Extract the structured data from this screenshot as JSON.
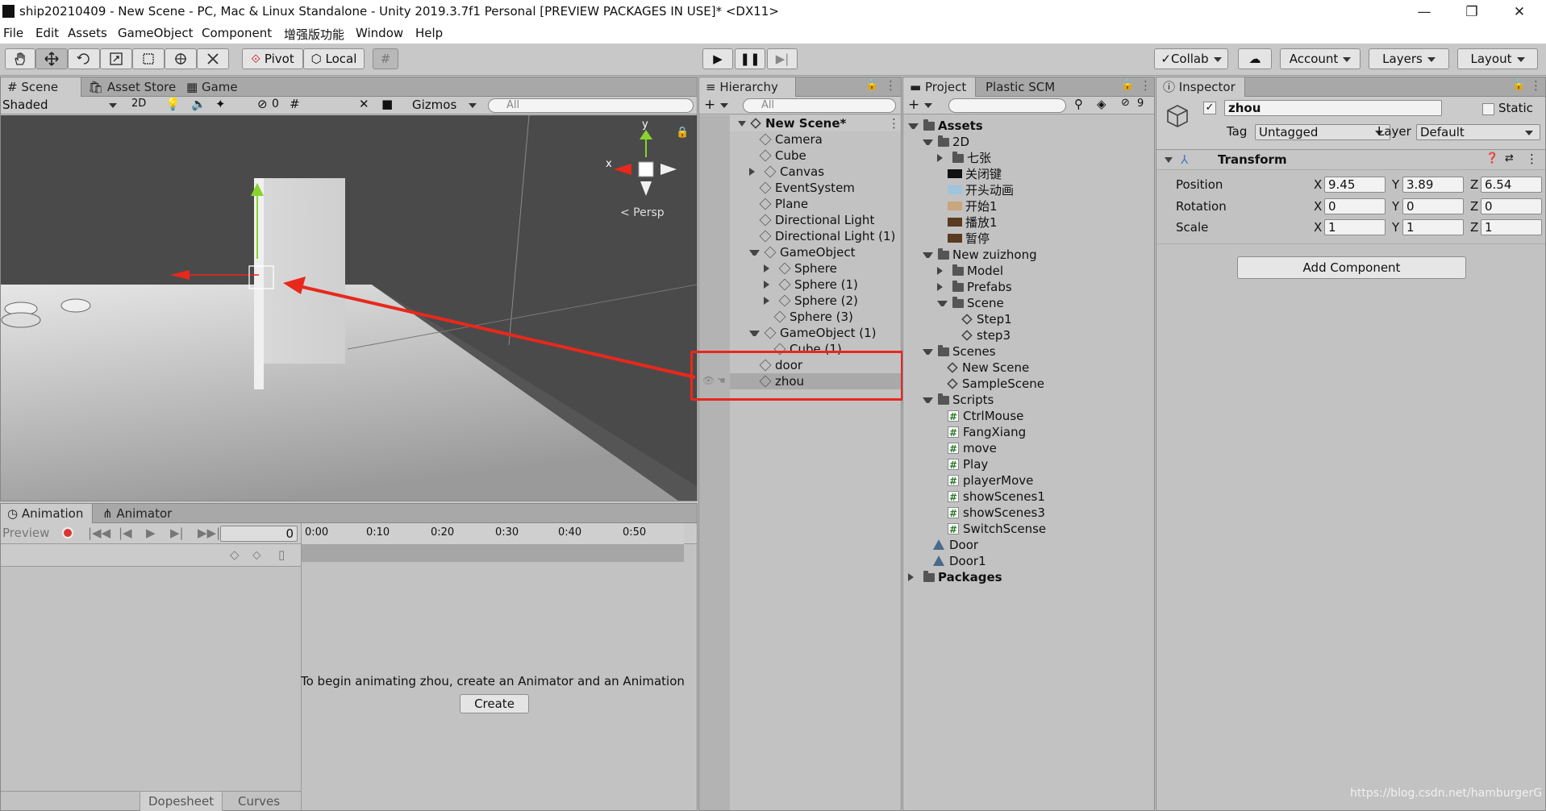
{
  "window": {
    "title": "ship20210409 - New Scene - PC, Mac & Linux Standalone - Unity 2019.3.7f1 Personal [PREVIEW PACKAGES IN USE]* <DX11>",
    "minimize": "—",
    "maximize": "❐",
    "close": "✕"
  },
  "menu": [
    "File",
    "Edit",
    "Assets",
    "GameObject",
    "Component",
    "增强版功能",
    "Window",
    "Help"
  ],
  "toolbar": {
    "pivot": "Pivot",
    "local": "Local",
    "collab": "Collab",
    "account": "Account",
    "layers": "Layers",
    "layout": "Layout"
  },
  "scene_panel": {
    "tabs": [
      "Scene",
      "Asset Store",
      "Game"
    ],
    "shading": "Shaded",
    "mode_2d": "2D",
    "hidden_count": "0",
    "gizmos": "Gizmos",
    "search_placeholder": "All",
    "persp": "< Persp",
    "axis_x": "x",
    "axis_y": "y"
  },
  "animation_panel": {
    "tabs": [
      "Animation",
      "Animator"
    ],
    "preview": "Preview",
    "frame": "0",
    "timeline_ticks": [
      "0:00",
      "0:10",
      "0:20",
      "0:30",
      "0:40",
      "0:50"
    ],
    "message": "To begin animating zhou, create an Animator and an Animation Clip.",
    "create": "Create",
    "dopesheet": "Dopesheet",
    "curves": "Curves"
  },
  "hierarchy": {
    "tab": "Hierarchy",
    "search_placeholder": "All",
    "scene_name": "New Scene*",
    "items": [
      {
        "label": "Camera",
        "depth": 1,
        "arrow": "",
        "selected": false
      },
      {
        "label": "Cube",
        "depth": 1,
        "arrow": "",
        "selected": false
      },
      {
        "label": "Canvas",
        "depth": 1,
        "arrow": "right",
        "selected": false
      },
      {
        "label": "EventSystem",
        "depth": 1,
        "arrow": "",
        "selected": false
      },
      {
        "label": "Plane",
        "depth": 1,
        "arrow": "",
        "selected": false
      },
      {
        "label": "Directional Light",
        "depth": 1,
        "arrow": "",
        "selected": false
      },
      {
        "label": "Directional Light (1)",
        "depth": 1,
        "arrow": "",
        "selected": false
      },
      {
        "label": "GameObject",
        "depth": 1,
        "arrow": "down",
        "selected": false
      },
      {
        "label": "Sphere",
        "depth": 2,
        "arrow": "right",
        "selected": false
      },
      {
        "label": "Sphere (1)",
        "depth": 2,
        "arrow": "right",
        "selected": false
      },
      {
        "label": "Sphere (2)",
        "depth": 2,
        "arrow": "right",
        "selected": false
      },
      {
        "label": "Sphere (3)",
        "depth": 2,
        "arrow": "",
        "selected": false
      },
      {
        "label": "GameObject (1)",
        "depth": 1,
        "arrow": "down",
        "selected": false
      },
      {
        "label": "Cube (1)",
        "depth": 2,
        "arrow": "",
        "selected": false
      },
      {
        "label": "door",
        "depth": 1,
        "arrow": "",
        "selected": false
      },
      {
        "label": "zhou",
        "depth": 1,
        "arrow": "",
        "selected": true
      }
    ]
  },
  "project": {
    "tabs": [
      "Project",
      "Plastic SCM"
    ],
    "badge": "9",
    "items": [
      {
        "label": "Assets",
        "depth": 0,
        "arrow": "down",
        "icon": "folder",
        "bold": true
      },
      {
        "label": "2D",
        "depth": 1,
        "arrow": "down",
        "icon": "folder"
      },
      {
        "label": "七张",
        "depth": 2,
        "arrow": "right",
        "icon": "folder"
      },
      {
        "label": "关闭键",
        "depth": 2,
        "arrow": "",
        "icon": "image-black"
      },
      {
        "label": "开头动画",
        "depth": 2,
        "arrow": "",
        "icon": "image-light"
      },
      {
        "label": "开始1",
        "depth": 2,
        "arrow": "",
        "icon": "image-tan"
      },
      {
        "label": "播放1",
        "depth": 2,
        "arrow": "",
        "icon": "image-brown"
      },
      {
        "label": "暂停",
        "depth": 2,
        "arrow": "",
        "icon": "image-brown"
      },
      {
        "label": "New zuizhong",
        "depth": 1,
        "arrow": "down",
        "icon": "folder"
      },
      {
        "label": "Model",
        "depth": 2,
        "arrow": "right",
        "icon": "folder"
      },
      {
        "label": "Prefabs",
        "depth": 2,
        "arrow": "right",
        "icon": "folder"
      },
      {
        "label": "Scene",
        "depth": 2,
        "arrow": "down",
        "icon": "folder"
      },
      {
        "label": "Step1",
        "depth": 3,
        "arrow": "",
        "icon": "scene"
      },
      {
        "label": "step3",
        "depth": 3,
        "arrow": "",
        "icon": "scene"
      },
      {
        "label": "Scenes",
        "depth": 1,
        "arrow": "down",
        "icon": "folder"
      },
      {
        "label": "New Scene",
        "depth": 2,
        "arrow": "",
        "icon": "scene"
      },
      {
        "label": "SampleScene",
        "depth": 2,
        "arrow": "",
        "icon": "scene"
      },
      {
        "label": "Scripts",
        "depth": 1,
        "arrow": "down",
        "icon": "folder"
      },
      {
        "label": "CtrlMouse",
        "depth": 2,
        "arrow": "",
        "icon": "script"
      },
      {
        "label": "FangXiang",
        "depth": 2,
        "arrow": "",
        "icon": "script"
      },
      {
        "label": "move",
        "depth": 2,
        "arrow": "",
        "icon": "script"
      },
      {
        "label": "Play",
        "depth": 2,
        "arrow": "",
        "icon": "script"
      },
      {
        "label": "playerMove",
        "depth": 2,
        "arrow": "",
        "icon": "script"
      },
      {
        "label": "showScenes1",
        "depth": 2,
        "arrow": "",
        "icon": "script"
      },
      {
        "label": "showScenes3",
        "depth": 2,
        "arrow": "",
        "icon": "script"
      },
      {
        "label": "SwitchScense",
        "depth": 2,
        "arrow": "",
        "icon": "script"
      },
      {
        "label": "Door",
        "depth": 1,
        "arrow": "",
        "icon": "prefab"
      },
      {
        "label": "Door1",
        "depth": 1,
        "arrow": "",
        "icon": "prefab"
      },
      {
        "label": "Packages",
        "depth": 0,
        "arrow": "right",
        "icon": "folder",
        "bold": true
      }
    ]
  },
  "inspector": {
    "tab": "Inspector",
    "object_name": "zhou",
    "static": "Static",
    "tag_label": "Tag",
    "tag_value": "Untagged",
    "layer_label": "Layer",
    "layer_value": "Default",
    "component": "Transform",
    "position_label": "Position",
    "rotation_label": "Rotation",
    "scale_label": "Scale",
    "position": {
      "x": "9.45",
      "y": "3.89",
      "z": "6.54"
    },
    "rotation": {
      "x": "0",
      "y": "0",
      "z": "0"
    },
    "scale": {
      "x": "1",
      "y": "1",
      "z": "1"
    },
    "add_component": "Add Component"
  },
  "watermark": "https://blog.csdn.net/hamburgerG",
  "colors": {
    "annotation_red": "#e8281c",
    "selection": "#a9a9a9",
    "scene_dark": "#4a4a4a"
  }
}
